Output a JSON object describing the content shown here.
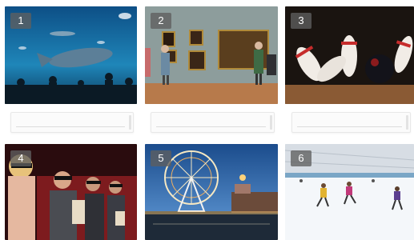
{
  "tiles": [
    {
      "number": "1",
      "scene": "aquarium-icon"
    },
    {
      "number": "2",
      "scene": "art-gallery-icon"
    },
    {
      "number": "3",
      "scene": "bowling-icon"
    },
    {
      "number": "4",
      "scene": "cinema-icon"
    },
    {
      "number": "5",
      "scene": "ferris-wheel-icon"
    },
    {
      "number": "6",
      "scene": "ice-rink-icon"
    }
  ],
  "answers": [
    {
      "value": ""
    },
    {
      "value": ""
    },
    {
      "value": ""
    }
  ],
  "colors": {
    "badge_bg": "#5f5f5f",
    "badge_text": "#ffffff",
    "answer_border": "#e8e8e8"
  }
}
